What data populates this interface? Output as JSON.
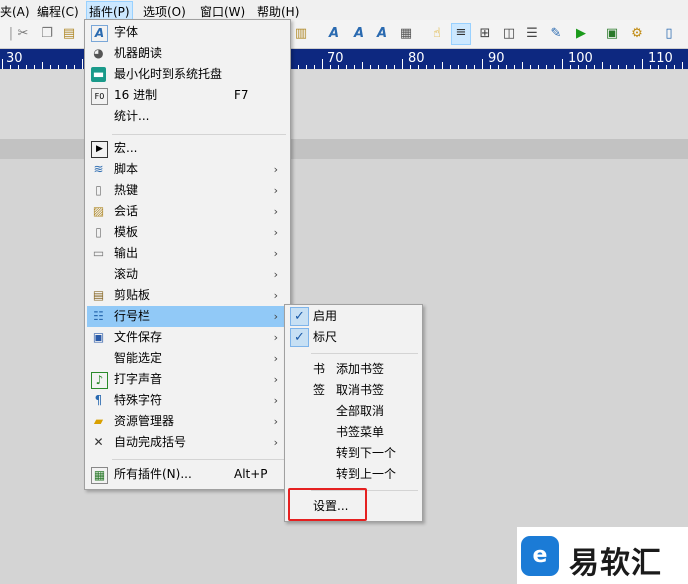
{
  "menubar": {
    "items": [
      "夹(A)",
      "编程(C)",
      "插件(P)",
      "选项(O)",
      "窗口(W)",
      "帮助(H)"
    ]
  },
  "toolbar": {
    "icons": [
      "cut-icon",
      "copy-icon",
      "paste-icon",
      "font-a-icon",
      "font-a-icon",
      "font-a-icon",
      "grid-icon",
      "hand-icon",
      "list-icon",
      "table-icon",
      "columns-icon",
      "rows-icon",
      "tool-icon",
      "play-icon",
      "macro-icon",
      "gear-icon",
      "notebook-icon"
    ]
  },
  "ruler": {
    "numbers": [
      "30",
      "70",
      "80",
      "90",
      "100",
      "110"
    ]
  },
  "plugin_menu": {
    "items": [
      {
        "label": "字体",
        "icon": "font-icon"
      },
      {
        "label": "机器朗读",
        "icon": "speech-icon"
      },
      {
        "label": "最小化时到系统托盘",
        "icon": "tray-icon"
      },
      {
        "label": "16 进制",
        "shortcut": "F7",
        "icon": "hex-icon"
      },
      {
        "label": "统计...",
        "icon": ""
      },
      {
        "label": "宏...",
        "icon": "macro-icon"
      },
      {
        "label": "脚本",
        "icon": "script-icon",
        "submenu": true
      },
      {
        "label": "热键",
        "icon": "hotkey-icon",
        "submenu": true
      },
      {
        "label": "会话",
        "icon": "session-icon",
        "submenu": true
      },
      {
        "label": "模板",
        "icon": "template-icon",
        "submenu": true
      },
      {
        "label": "输出",
        "icon": "output-icon",
        "submenu": true
      },
      {
        "label": "滚动",
        "icon": "",
        "submenu": true
      },
      {
        "label": "剪贴板",
        "icon": "clipboard-icon",
        "submenu": true
      },
      {
        "label": "行号栏",
        "icon": "linenumber-icon",
        "submenu": true
      },
      {
        "label": "文件保存",
        "icon": "save-icon",
        "submenu": true
      },
      {
        "label": "智能选定",
        "icon": "",
        "submenu": true
      },
      {
        "label": "打字声音",
        "icon": "sound-icon",
        "submenu": true
      },
      {
        "label": "特殊字符",
        "icon": "pilcrow-icon",
        "submenu": true
      },
      {
        "label": "资源管理器",
        "icon": "folder-icon",
        "submenu": true
      },
      {
        "label": "自动完成括号",
        "icon": "bracket-icon",
        "submenu": true
      },
      {
        "label": "所有插件(N)...",
        "shortcut": "Alt+P",
        "icon": "plugins-icon"
      }
    ]
  },
  "linenumber_submenu": {
    "items": [
      {
        "label": "启用",
        "checked": true
      },
      {
        "label": "标尺",
        "checked": true
      },
      {
        "label": "添加书签",
        "tag": "书"
      },
      {
        "label": "取消书签",
        "tag": "签"
      },
      {
        "label": "全部取消"
      },
      {
        "label": "书签菜单"
      },
      {
        "label": "转到下一个"
      },
      {
        "label": "转到上一个"
      },
      {
        "label": "设置..."
      }
    ]
  },
  "watermark": {
    "brand_text": "易软汇",
    "mark_glyph": "e"
  },
  "colors": {
    "highlight": "#91c9f7",
    "ruler": "#0d2880",
    "annotation": "#e52020",
    "logo": "#1b7bd6"
  }
}
